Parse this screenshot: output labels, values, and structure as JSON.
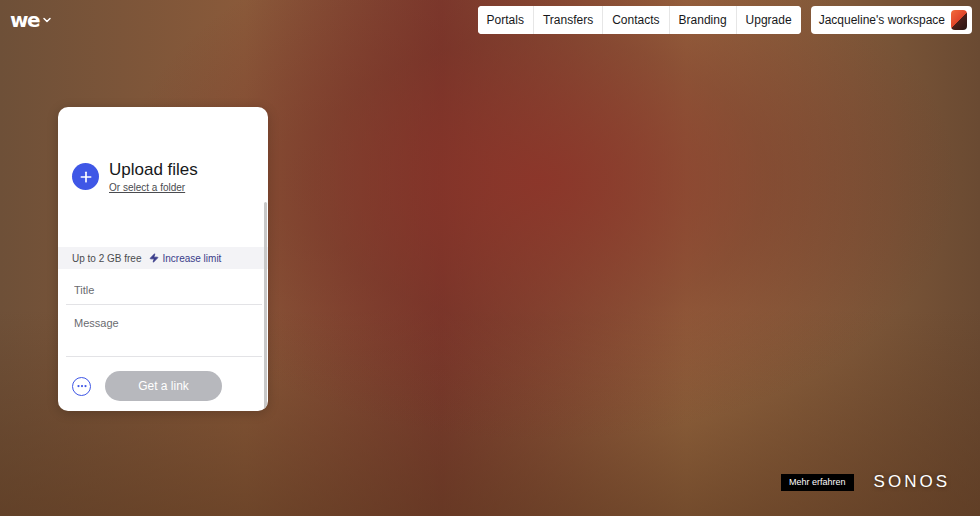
{
  "logo": {
    "text": "we"
  },
  "nav": [
    {
      "label": "Portals"
    },
    {
      "label": "Transfers"
    },
    {
      "label": "Contacts"
    },
    {
      "label": "Branding"
    },
    {
      "label": "Upgrade"
    }
  ],
  "workspace": {
    "label": "Jacqueline's workspace"
  },
  "upload": {
    "title": "Upload files",
    "folder_link": "Or select a folder"
  },
  "limit": {
    "text": "Up to 2 GB free",
    "action": "Increase limit"
  },
  "fields": [
    {
      "kind": "input",
      "placeholder": "Title"
    },
    {
      "kind": "textarea",
      "placeholder": "Message"
    }
  ],
  "submit": {
    "label": "Get a link",
    "disabled": true
  },
  "ad": {
    "cta": "Mehr erfahren",
    "brand": "SONOS"
  }
}
